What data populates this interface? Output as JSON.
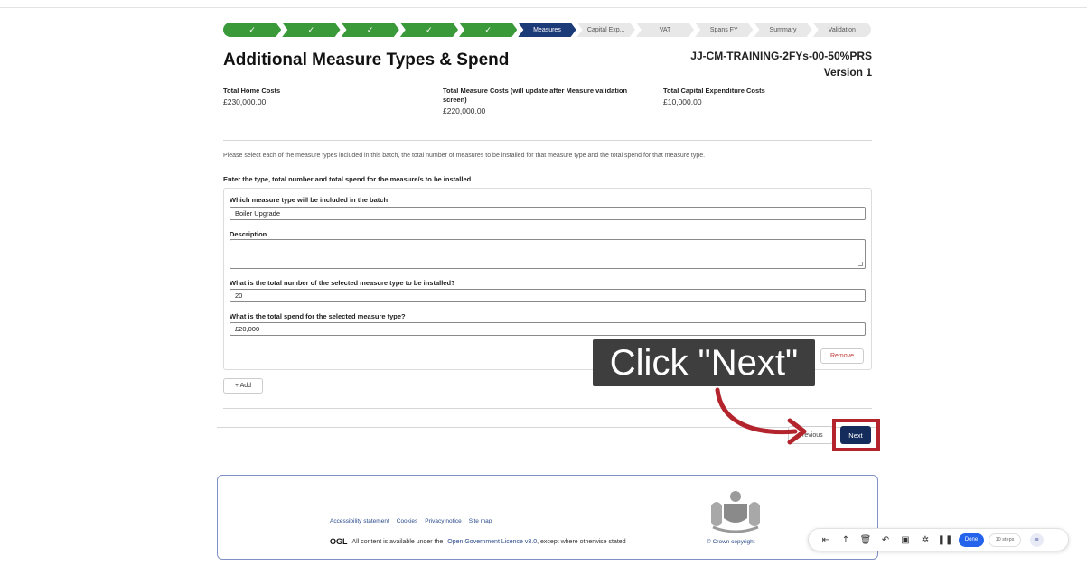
{
  "progress": {
    "steps": [
      {
        "label": "✓",
        "state": "done"
      },
      {
        "label": "✓",
        "state": "done"
      },
      {
        "label": "✓",
        "state": "done"
      },
      {
        "label": "✓",
        "state": "done"
      },
      {
        "label": "✓",
        "state": "done"
      },
      {
        "label": "Measures",
        "state": "current"
      },
      {
        "label": "Capital Exp...",
        "state": "todo"
      },
      {
        "label": "VAT",
        "state": "todo"
      },
      {
        "label": "Spans FY",
        "state": "todo"
      },
      {
        "label": "Summary",
        "state": "todo"
      },
      {
        "label": "Validation",
        "state": "todo"
      }
    ]
  },
  "header": {
    "title": "Additional Measure Types & Spend",
    "record_name": "JJ-CM-TRAINING-2FYs-00-50%PRS",
    "version": "Version 1"
  },
  "summary": {
    "total_home_costs_label": "Total Home Costs",
    "total_home_costs_value": "£230,000.00",
    "total_measure_costs_label": "Total Measure Costs (will update after Measure validation screen)",
    "total_measure_costs_value": "£220,000.00",
    "total_capex_label": "Total Capital Expenditure Costs",
    "total_capex_value": "£10,000.00"
  },
  "instructions": {
    "intro": "Please select each of the measure types included in this batch, the total number of measures to be installed for that measure type and the total spend for that measure type.",
    "subheading": "Enter the type, total number and total spend for the measure/s to be installed"
  },
  "measure": {
    "type_label": "Which measure type will be included in the batch",
    "type_value": "Boiler Upgrade",
    "description_label": "Description",
    "description_value": "",
    "number_label": "What is the total number of the selected measure type to be installed?",
    "number_value": "20",
    "spend_label": "What is the total spend for the selected measure type?",
    "spend_value": "£20,000",
    "remove_label": "Remove"
  },
  "actions": {
    "add_label": "+ Add",
    "previous_label": "Previous",
    "next_label": "Next"
  },
  "annotation": {
    "callout_text": "Click \"Next\"",
    "highlight_color": "#b3242c"
  },
  "footer": {
    "links": [
      "Accessibility statement",
      "Cookies",
      "Privacy notice",
      "Site map"
    ],
    "ogl_mark": "OGL",
    "licence_prefix": "All content is available under the",
    "licence_link": "Open Government Licence v3.0",
    "licence_suffix": ", except where otherwise stated",
    "crown_copyright": "© Crown copyright"
  },
  "recorder": {
    "icons": [
      "skip-start-icon",
      "pointer-icon",
      "trash-icon",
      "undo-icon",
      "image-icon",
      "settings-icon",
      "pause-icon"
    ],
    "done_label": "Done",
    "steps_label": "10 steps"
  },
  "colors": {
    "done_green": "#3a9a3a",
    "current_navy": "#1b3a78",
    "next_button": "#142c5c"
  }
}
